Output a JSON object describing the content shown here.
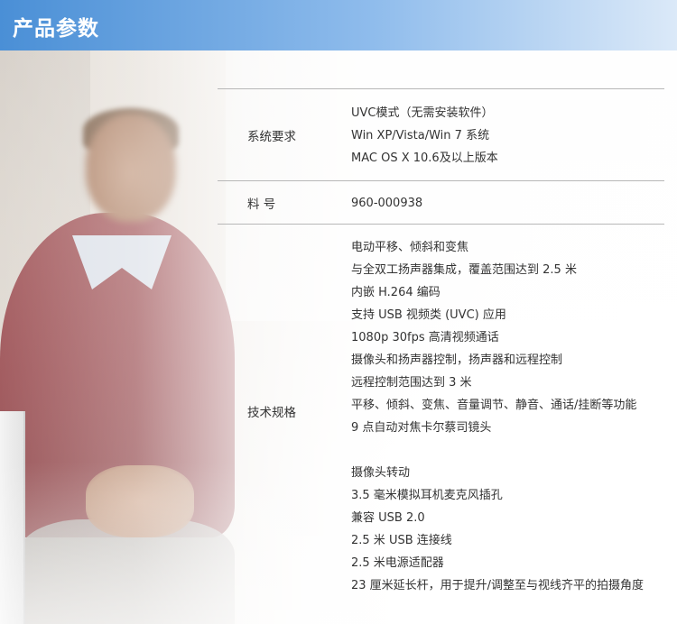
{
  "header": {
    "title": "产品参数",
    "accent": "#4a8fd6"
  },
  "specs": {
    "system": {
      "label": "系统要求",
      "lines": [
        "UVC模式（无需安装软件）",
        "Win XP/Vista/Win 7 系统",
        "MAC OS X 10.6及以上版本"
      ]
    },
    "part": {
      "label": "料 号",
      "lines": [
        "960-000938"
      ]
    },
    "tech": {
      "label": "技术规格",
      "lines": [
        "电动平移、倾斜和变焦",
        "与全双工扬声器集成，覆盖范围达到 2.5 米",
        "内嵌 H.264 编码",
        "支持 USB 视频类 (UVC) 应用",
        "1080p 30fps 高清视频通话",
        "摄像头和扬声器控制，扬声器和远程控制",
        "远程控制范围达到 3 米",
        "平移、倾斜、变焦、音量调节、静音、通话/挂断等功能",
        "9 点自动对焦卡尔蔡司镜头",
        "",
        "摄像头转动",
        "3.5 毫米模拟耳机麦克风插孔",
        "兼容 USB 2.0",
        "2.5 米 USB 连接线",
        "2.5 米电源适配器",
        "23 厘米延长杆，用于提升/调整至与视线齐平的拍摄角度"
      ]
    }
  }
}
